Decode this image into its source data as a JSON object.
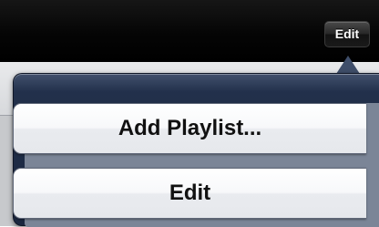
{
  "navbar": {
    "edit_label": "Edit"
  },
  "popover": {
    "items": [
      {
        "label": "Add Playlist..."
      },
      {
        "label": "Edit"
      }
    ]
  },
  "colors": {
    "navbar_bg": "#000000",
    "popover_bg": "#22304b",
    "button_bg": "#f2f3f5",
    "button_text": "#111111"
  }
}
